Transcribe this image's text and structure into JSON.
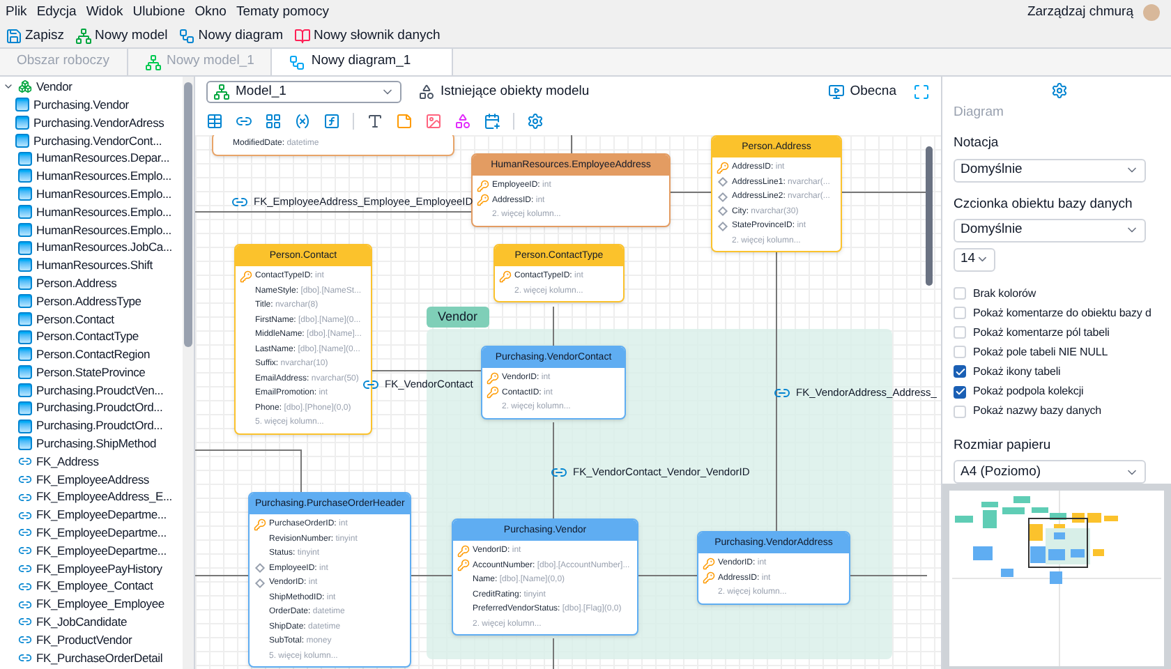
{
  "menu": [
    "Plik",
    "Edycja",
    "Widok",
    "Ulubione",
    "Okno",
    "Tematy pomocy"
  ],
  "toolbar": [
    {
      "label": "Zapisz",
      "kind": "save"
    },
    {
      "label": "Nowy model",
      "kind": "model"
    },
    {
      "label": "Nowy diagram",
      "kind": "diagram"
    },
    {
      "label": "Nowy słownik danych",
      "kind": "dictionary"
    }
  ],
  "account": {
    "label": "Zarządzaj chmurą"
  },
  "tabs": [
    {
      "label": "Obszar roboczy",
      "selected": false,
      "kind": "plain"
    },
    {
      "label": "Nowy model_1",
      "selected": false,
      "kind": "model"
    },
    {
      "label": "Nowy diagram_1",
      "selected": true,
      "kind": "diagram"
    }
  ],
  "tree": [
    {
      "label": "Vendor",
      "kind": "group",
      "expanded": true,
      "children": [
        {
          "label": "Purchasing.Vendor",
          "kind": "table"
        },
        {
          "label": "Purchasing.VendorAdress",
          "kind": "table"
        },
        {
          "label": "Purchasing.VendorCont...",
          "kind": "table"
        }
      ]
    },
    {
      "label": "HumanResources.Depar...",
      "kind": "table"
    },
    {
      "label": "HumanResources.Emplo...",
      "kind": "table"
    },
    {
      "label": "HumanResources.Emplo...",
      "kind": "table"
    },
    {
      "label": "HumanResources.Emplo...",
      "kind": "table"
    },
    {
      "label": "HumanResources.Emplo...",
      "kind": "table"
    },
    {
      "label": "HumanResources.JobCa...",
      "kind": "table"
    },
    {
      "label": "HumanResources.Shift",
      "kind": "table"
    },
    {
      "label": "Person.Address",
      "kind": "table"
    },
    {
      "label": "Person.AddressType",
      "kind": "table"
    },
    {
      "label": "Person.Contact",
      "kind": "table"
    },
    {
      "label": "Person.ContactType",
      "kind": "table"
    },
    {
      "label": "Person.ContactRegion",
      "kind": "table"
    },
    {
      "label": "Person.StateProvince",
      "kind": "table"
    },
    {
      "label": "Purchasing.ProudctVen...",
      "kind": "table"
    },
    {
      "label": "Purchasing.ProudctOrd...",
      "kind": "table"
    },
    {
      "label": "Purchasing.ProudctOrd...",
      "kind": "table"
    },
    {
      "label": "Purchasing.ShipMethod",
      "kind": "table"
    },
    {
      "label": "FK_Address",
      "kind": "relation"
    },
    {
      "label": "FK_EmployeeAddress",
      "kind": "relation"
    },
    {
      "label": "FK_EmployeeAddress_E...",
      "kind": "relation"
    },
    {
      "label": "FK_EmployeeDepartme...",
      "kind": "relation"
    },
    {
      "label": "FK_EmployeeDepartme...",
      "kind": "relation"
    },
    {
      "label": "FK_EmployeeDepartme...",
      "kind": "relation"
    },
    {
      "label": "FK_EmployeePayHistory",
      "kind": "relation"
    },
    {
      "label": "FK_Employee_Contact",
      "kind": "relation"
    },
    {
      "label": "FK_Employee_Employee",
      "kind": "relation"
    },
    {
      "label": "FK_JobCandidate",
      "kind": "relation"
    },
    {
      "label": "FK_ProductVendor",
      "kind": "relation"
    },
    {
      "label": "FK_PurchaseOrderDetail",
      "kind": "relation"
    }
  ],
  "diagram_toolbar": {
    "model": "Model_1",
    "existing_objects": "Istniejące obiekty modelu",
    "current": "Obecna"
  },
  "diagram": {
    "group": {
      "label": "Vendor"
    },
    "tables": [
      {
        "color": "#e8a468",
        "columns": [
          {
            "name": "ModifiedDate:",
            "type": "datetime",
            "kind": "plain"
          }
        ]
      },
      {
        "name": "HumanResources.EmployeeAddress",
        "color": "#e39c62",
        "columns": [
          {
            "name": "EmployeeID:",
            "type": "int",
            "kind": "primary"
          },
          {
            "name": "AddressID:",
            "type": "int",
            "kind": "primary"
          }
        ],
        "more": "2. więcej kolumn..."
      },
      {
        "name": "Person.Address",
        "color": "#fbc22c",
        "columns": [
          {
            "name": "AddressID:",
            "type": "int",
            "kind": "primary"
          },
          {
            "name": "AddressLine1:",
            "type": "nvarchar(...",
            "kind": "indexed"
          },
          {
            "name": "AddressLine2:",
            "type": "nvarchar(...",
            "kind": "indexed"
          },
          {
            "name": "City:",
            "type": "nvarchar(30)",
            "kind": "indexed"
          },
          {
            "name": "StateProvinceID:",
            "type": "int",
            "kind": "indexed"
          }
        ],
        "more": "2. więcej kolumn..."
      },
      {
        "name": "Person.Contact",
        "color": "#fbc22c",
        "columns": [
          {
            "name": "ContactTypeID:",
            "type": "int",
            "kind": "primary"
          },
          {
            "name": "NameStyle:",
            "type": "[dbo].[NameSt...",
            "kind": "plain"
          },
          {
            "name": "Title:",
            "type": "nvarchar(8)",
            "kind": "plain"
          },
          {
            "name": "FirstName:",
            "type": "[dbo].[Name](0...",
            "kind": "plain"
          },
          {
            "name": "MiddleName:",
            "type": "[dbo].[Name]...",
            "kind": "plain"
          },
          {
            "name": "LastName:",
            "type": "[dbo].[Name](0...",
            "kind": "plain"
          },
          {
            "name": "Suffix:",
            "type": "nvarchar(10)",
            "kind": "plain"
          },
          {
            "name": "EmailAddress:",
            "type": "nvarchar(50)",
            "kind": "plain"
          },
          {
            "name": "EmailPromotion:",
            "type": "int",
            "kind": "plain"
          },
          {
            "name": "Phone:",
            "type": "[dbo].[Phone](0,0)",
            "kind": "plain"
          }
        ],
        "more": "5. więcej kolumn..."
      },
      {
        "name": "Person.ContactType",
        "color": "#fbc22c",
        "columns": [
          {
            "name": "ContactTypeID:",
            "type": "int",
            "kind": "primary"
          }
        ],
        "more": "2. więcej kolumn..."
      },
      {
        "name": "Purchasing.VendorContact",
        "color": "#5fadf2",
        "columns": [
          {
            "name": "VendorID:",
            "type": "int",
            "kind": "primary"
          },
          {
            "name": "ContactID:",
            "type": "int",
            "kind": "primary"
          }
        ],
        "more": "2. więcej kolumn..."
      },
      {
        "name": "Purchasing.PurchaseOrderHeader",
        "color": "#5fadf2",
        "columns": [
          {
            "name": "PurchaseOrderID:",
            "type": "int",
            "kind": "primary"
          },
          {
            "name": "RevisionNumber:",
            "type": "tinyint",
            "kind": "plain"
          },
          {
            "name": "Status:",
            "type": "tinyint",
            "kind": "plain"
          },
          {
            "name": "EmployeeID:",
            "type": "int",
            "kind": "indexed"
          },
          {
            "name": "VendorID:",
            "type": "int",
            "kind": "indexed"
          },
          {
            "name": "ShipMethodID:",
            "type": "int",
            "kind": "plain"
          },
          {
            "name": "OrderDate:",
            "type": "datetime",
            "kind": "plain"
          },
          {
            "name": "ShipDate:",
            "type": "datetime",
            "kind": "plain"
          },
          {
            "name": "SubTotal:",
            "type": "money",
            "kind": "plain"
          }
        ],
        "more": "5. więcej kolumn..."
      },
      {
        "name": "Purchasing.Vendor",
        "color": "#5fadf2",
        "columns": [
          {
            "name": "VendorID:",
            "type": "int",
            "kind": "primary"
          },
          {
            "name": "AccountNumber:",
            "type": "[dbo].[AccountNumber]...",
            "kind": "primary"
          },
          {
            "name": "Name:",
            "type": "[dbo].[Name](0,0)",
            "kind": "plain"
          },
          {
            "name": "CreditRating:",
            "type": "tinyint",
            "kind": "plain"
          },
          {
            "name": "PreferredVendorStatus:",
            "type": "[dbo].[Flag](0,0)",
            "kind": "plain"
          }
        ],
        "more": "2. więcej kolumn..."
      },
      {
        "name": "Purchasing.VendorAddress",
        "color": "#5fadf2",
        "columns": [
          {
            "name": "VendorID:",
            "type": "int",
            "kind": "primary"
          },
          {
            "name": "AddressID:",
            "type": "int",
            "kind": "primary"
          }
        ],
        "more": "2. więcej kolumn..."
      }
    ],
    "relations": [
      "FK_EmployeeAddress_Employee_EmployeeID",
      "FK_VendorContact",
      "FK_VendorContact_Vendor_VendorID",
      "FK_VendorAddress_Address_"
    ]
  },
  "panel": {
    "title": "Diagram",
    "notation_label": "Notacja",
    "notation": "Domyślnie",
    "font_label": "Czcionka obiektu bazy danych",
    "font": "Domyślnie",
    "font_size": "14",
    "options": [
      {
        "label": "Brak kolorów",
        "checked": false
      },
      {
        "label": "Pokaż komentarze do obiektu bazy d",
        "checked": false
      },
      {
        "label": "Pokaż komentarze pól tabeli",
        "checked": false
      },
      {
        "label": "Pokaż pole tabeli NIE NULL",
        "checked": false
      },
      {
        "label": "Pokaż ikony tabeli",
        "checked": true
      },
      {
        "label": "Pokaż podpola kolekcji",
        "checked": true
      },
      {
        "label": "Pokaż nazwy bazy danych",
        "checked": false
      }
    ],
    "paper_label": "Rozmiar papieru",
    "paper": "A4 (Poziomo)"
  }
}
